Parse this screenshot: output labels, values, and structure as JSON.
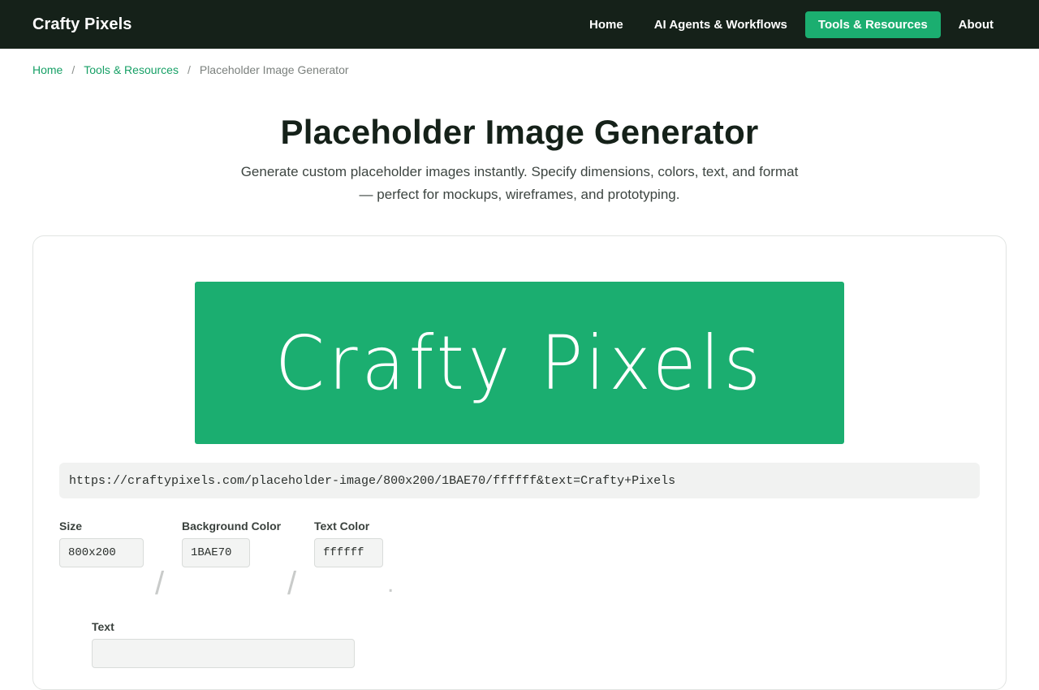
{
  "header": {
    "brand": "Crafty Pixels",
    "nav": [
      {
        "label": "Home"
      },
      {
        "label": "AI Agents & Workflows"
      },
      {
        "label": "Tools & Resources"
      },
      {
        "label": "About"
      }
    ]
  },
  "breadcrumb": {
    "items": [
      "Home",
      "Tools & Resources"
    ],
    "separator": "/",
    "current": "Placeholder Image Generator"
  },
  "page": {
    "title": "Placeholder Image Generator",
    "subtitle_line1": "Generate custom placeholder images instantly. Specify dimensions, colors, text, and format",
    "subtitle_line2": "— perfect for mockups, wireframes, and prototyping."
  },
  "generator": {
    "preview_text": "Crafty Pixels",
    "preview_bg": "#1BAE70",
    "preview_fg": "#ffffff",
    "url": "https://craftypixels.com/placeholder-image/800x200/1BAE70/ffffff&text=Crafty+Pixels",
    "size_label": "Size",
    "size_value": "800x200",
    "bg_label": "Background Color",
    "bg_value": "1BAE70",
    "fg_label": "Text Color",
    "fg_value": "ffffff",
    "slash": "/",
    "dot": ".",
    "text_label": "Text"
  },
  "colors": {
    "accent": "#1BAE70",
    "header_bg": "#152119"
  }
}
